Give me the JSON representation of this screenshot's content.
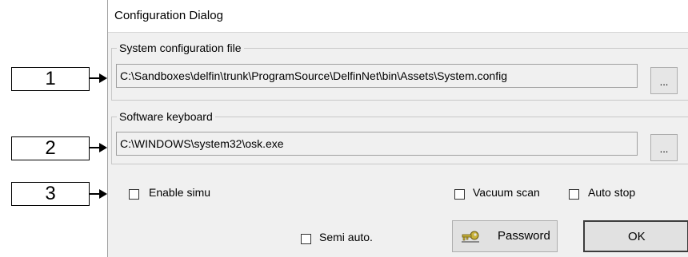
{
  "callouts": [
    "1",
    "2",
    "3"
  ],
  "dialog": {
    "title": "Configuration Dialog",
    "system_config": {
      "legend": "System configuration file",
      "path": "C:\\Sandboxes\\delfin\\trunk\\ProgramSource\\DelfinNet\\bin\\Assets\\System.config",
      "browse_label": "..."
    },
    "software_keyboard": {
      "legend": "Software keyboard",
      "path": "C:\\WINDOWS\\system32\\osk.exe",
      "browse_label": "..."
    },
    "options": {
      "enable_simu": {
        "label": "Enable simu",
        "checked": false
      },
      "vacuum_scan": {
        "label": "Vacuum scan",
        "checked": false
      },
      "auto_stop": {
        "label": "Auto stop",
        "checked": false
      },
      "semi_auto": {
        "label": "Semi auto.",
        "checked": false
      }
    },
    "buttons": {
      "password_label": "Password",
      "ok_label": "OK"
    }
  },
  "colors": {
    "dialog_bg": "#f0f0f0",
    "button_bg": "#e1e1e1",
    "key_icon": "#c9b23a"
  },
  "icons": {
    "password": "key-icon"
  }
}
